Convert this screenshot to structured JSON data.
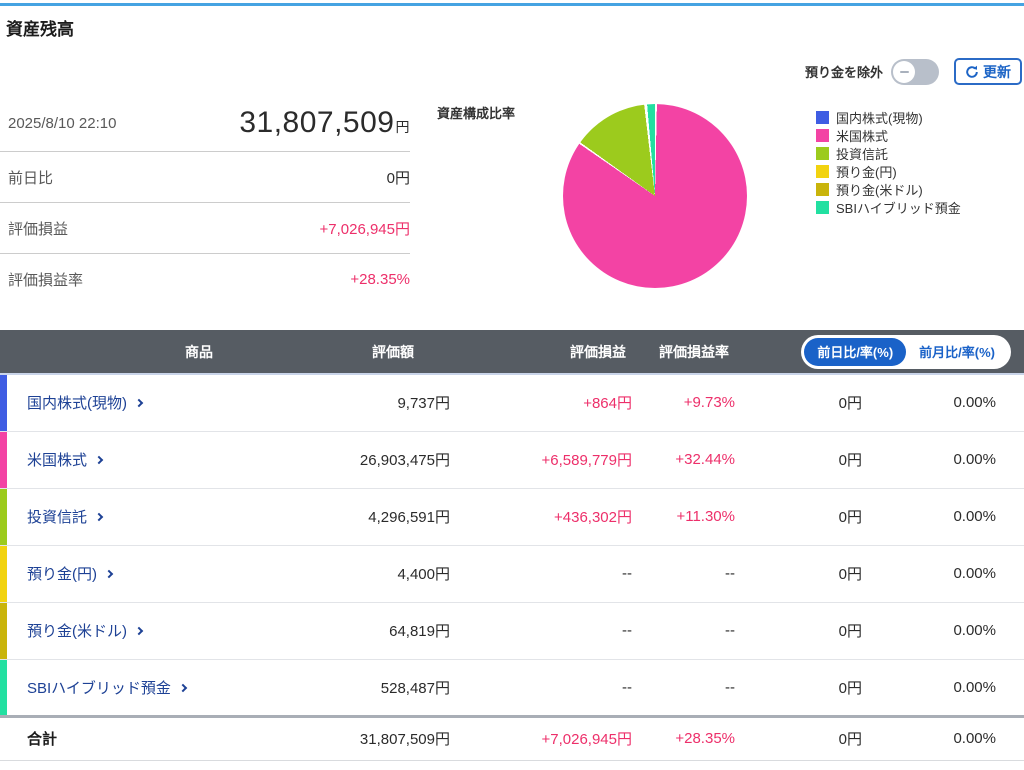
{
  "page": {
    "title": "資産残高"
  },
  "controls": {
    "toggle_label": "預り金を除外",
    "toggle_state": "off",
    "refresh_label": "更新"
  },
  "summary": {
    "timestamp": "2025/8/10 22:10",
    "total_value": "31,807,509",
    "total_unit": "円",
    "rows": [
      {
        "label": "前日比",
        "value": "0円"
      },
      {
        "label": "評価損益",
        "value": "+7,026,945円"
      },
      {
        "label": "評価損益率",
        "value": "+28.35%"
      }
    ]
  },
  "chart_data": {
    "type": "pie",
    "title": "資産構成比率",
    "legend_position": "right",
    "start_angle_deg": 0,
    "direction": "clockwise",
    "slices": [
      {
        "label": "国内株式(現物)",
        "value_yen": 9737,
        "pct": 0.03,
        "color": "#3f5de3"
      },
      {
        "label": "米国株式",
        "value_yen": 26903475,
        "pct": 84.58,
        "color": "#f343a4"
      },
      {
        "label": "投資信託",
        "value_yen": 4296591,
        "pct": 13.51,
        "color": "#9ccb1d"
      },
      {
        "label": "預り金(円)",
        "value_yen": 4400,
        "pct": 0.01,
        "color": "#f2d30f"
      },
      {
        "label": "預り金(米ドル)",
        "value_yen": 64819,
        "pct": 0.2,
        "color": "#c9b40b"
      },
      {
        "label": "SBIハイブリッド預金",
        "value_yen": 528487,
        "pct": 1.66,
        "color": "#22e0a1"
      }
    ]
  },
  "table": {
    "headers": {
      "product": "商品",
      "value": "評価額",
      "pl": "評価損益",
      "pl_rate": "評価損益率"
    },
    "period_tabs": [
      {
        "label": "前日比/率(%)",
        "active": true
      },
      {
        "label": "前月比/率(%)",
        "active": false
      }
    ],
    "rows": [
      {
        "name": "国内株式(現物)",
        "color": "#3f5de3",
        "value": "9,737円",
        "pl": "+864円",
        "pl_rate": "+9.73%",
        "day": "0円",
        "day_rate": "0.00%"
      },
      {
        "name": "米国株式",
        "color": "#f343a4",
        "value": "26,903,475円",
        "pl": "+6,589,779円",
        "pl_rate": "+32.44%",
        "day": "0円",
        "day_rate": "0.00%"
      },
      {
        "name": "投資信託",
        "color": "#9ccb1d",
        "value": "4,296,591円",
        "pl": "+436,302円",
        "pl_rate": "+11.30%",
        "day": "0円",
        "day_rate": "0.00%"
      },
      {
        "name": "預り金(円)",
        "color": "#f2d30f",
        "value": "4,400円",
        "pl": "--",
        "pl_rate": "--",
        "day": "0円",
        "day_rate": "0.00%"
      },
      {
        "name": "預り金(米ドル)",
        "color": "#c9b40b",
        "value": "64,819円",
        "pl": "--",
        "pl_rate": "--",
        "day": "0円",
        "day_rate": "0.00%"
      },
      {
        "name": "SBIハイブリッド預金",
        "color": "#22e0a1",
        "value": "528,487円",
        "pl": "--",
        "pl_rate": "--",
        "day": "0円",
        "day_rate": "0.00%"
      }
    ],
    "total": {
      "name": "合計",
      "value": "31,807,509円",
      "pl": "+7,026,945円",
      "pl_rate": "+28.35%",
      "day": "0円",
      "day_rate": "0.00%"
    }
  },
  "colors": {
    "accent_pink": "#ed2f6a",
    "link_blue": "#1d4195",
    "table_header_bg": "#565c63",
    "pill_blue": "#1a62c8",
    "top_line_blue": "#45a3e2",
    "toggle_off_gray": "#b8bfca"
  }
}
